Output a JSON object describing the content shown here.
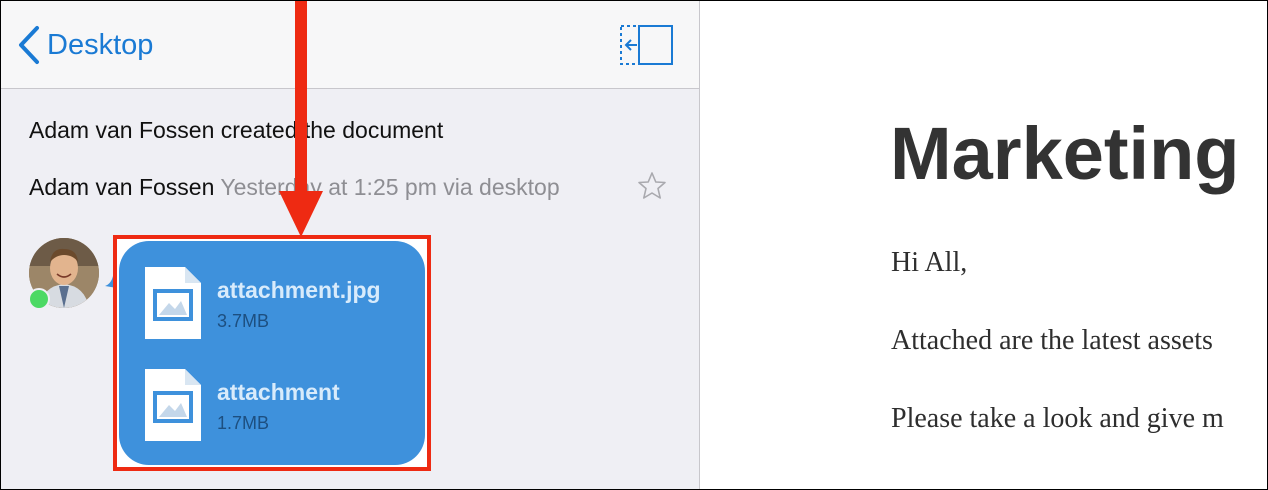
{
  "nav": {
    "back_label": "Desktop"
  },
  "feed": {
    "event1": {
      "author": "Adam van Fossen",
      "action": "created the document"
    },
    "event2": {
      "author": "Adam van Fossen",
      "meta": "Yesterday at 1:25 pm via desktop"
    }
  },
  "attachments": [
    {
      "name": "attachment.jpg",
      "size": "3.7MB"
    },
    {
      "name": "attachment",
      "size": "1.7MB"
    }
  ],
  "document": {
    "title": "Marketing",
    "paragraphs": [
      "Hi All,",
      "Attached are the latest assets",
      "Please take a look and give m"
    ]
  },
  "colors": {
    "accent": "#1a7ad4",
    "bubble": "#3e91dc",
    "highlight": "#ee2a12",
    "online": "#4cd964"
  },
  "icons": [
    "chevron-left-icon",
    "sidebar-toggle-icon",
    "star-icon",
    "image-file-icon",
    "arrow-down-icon"
  ]
}
